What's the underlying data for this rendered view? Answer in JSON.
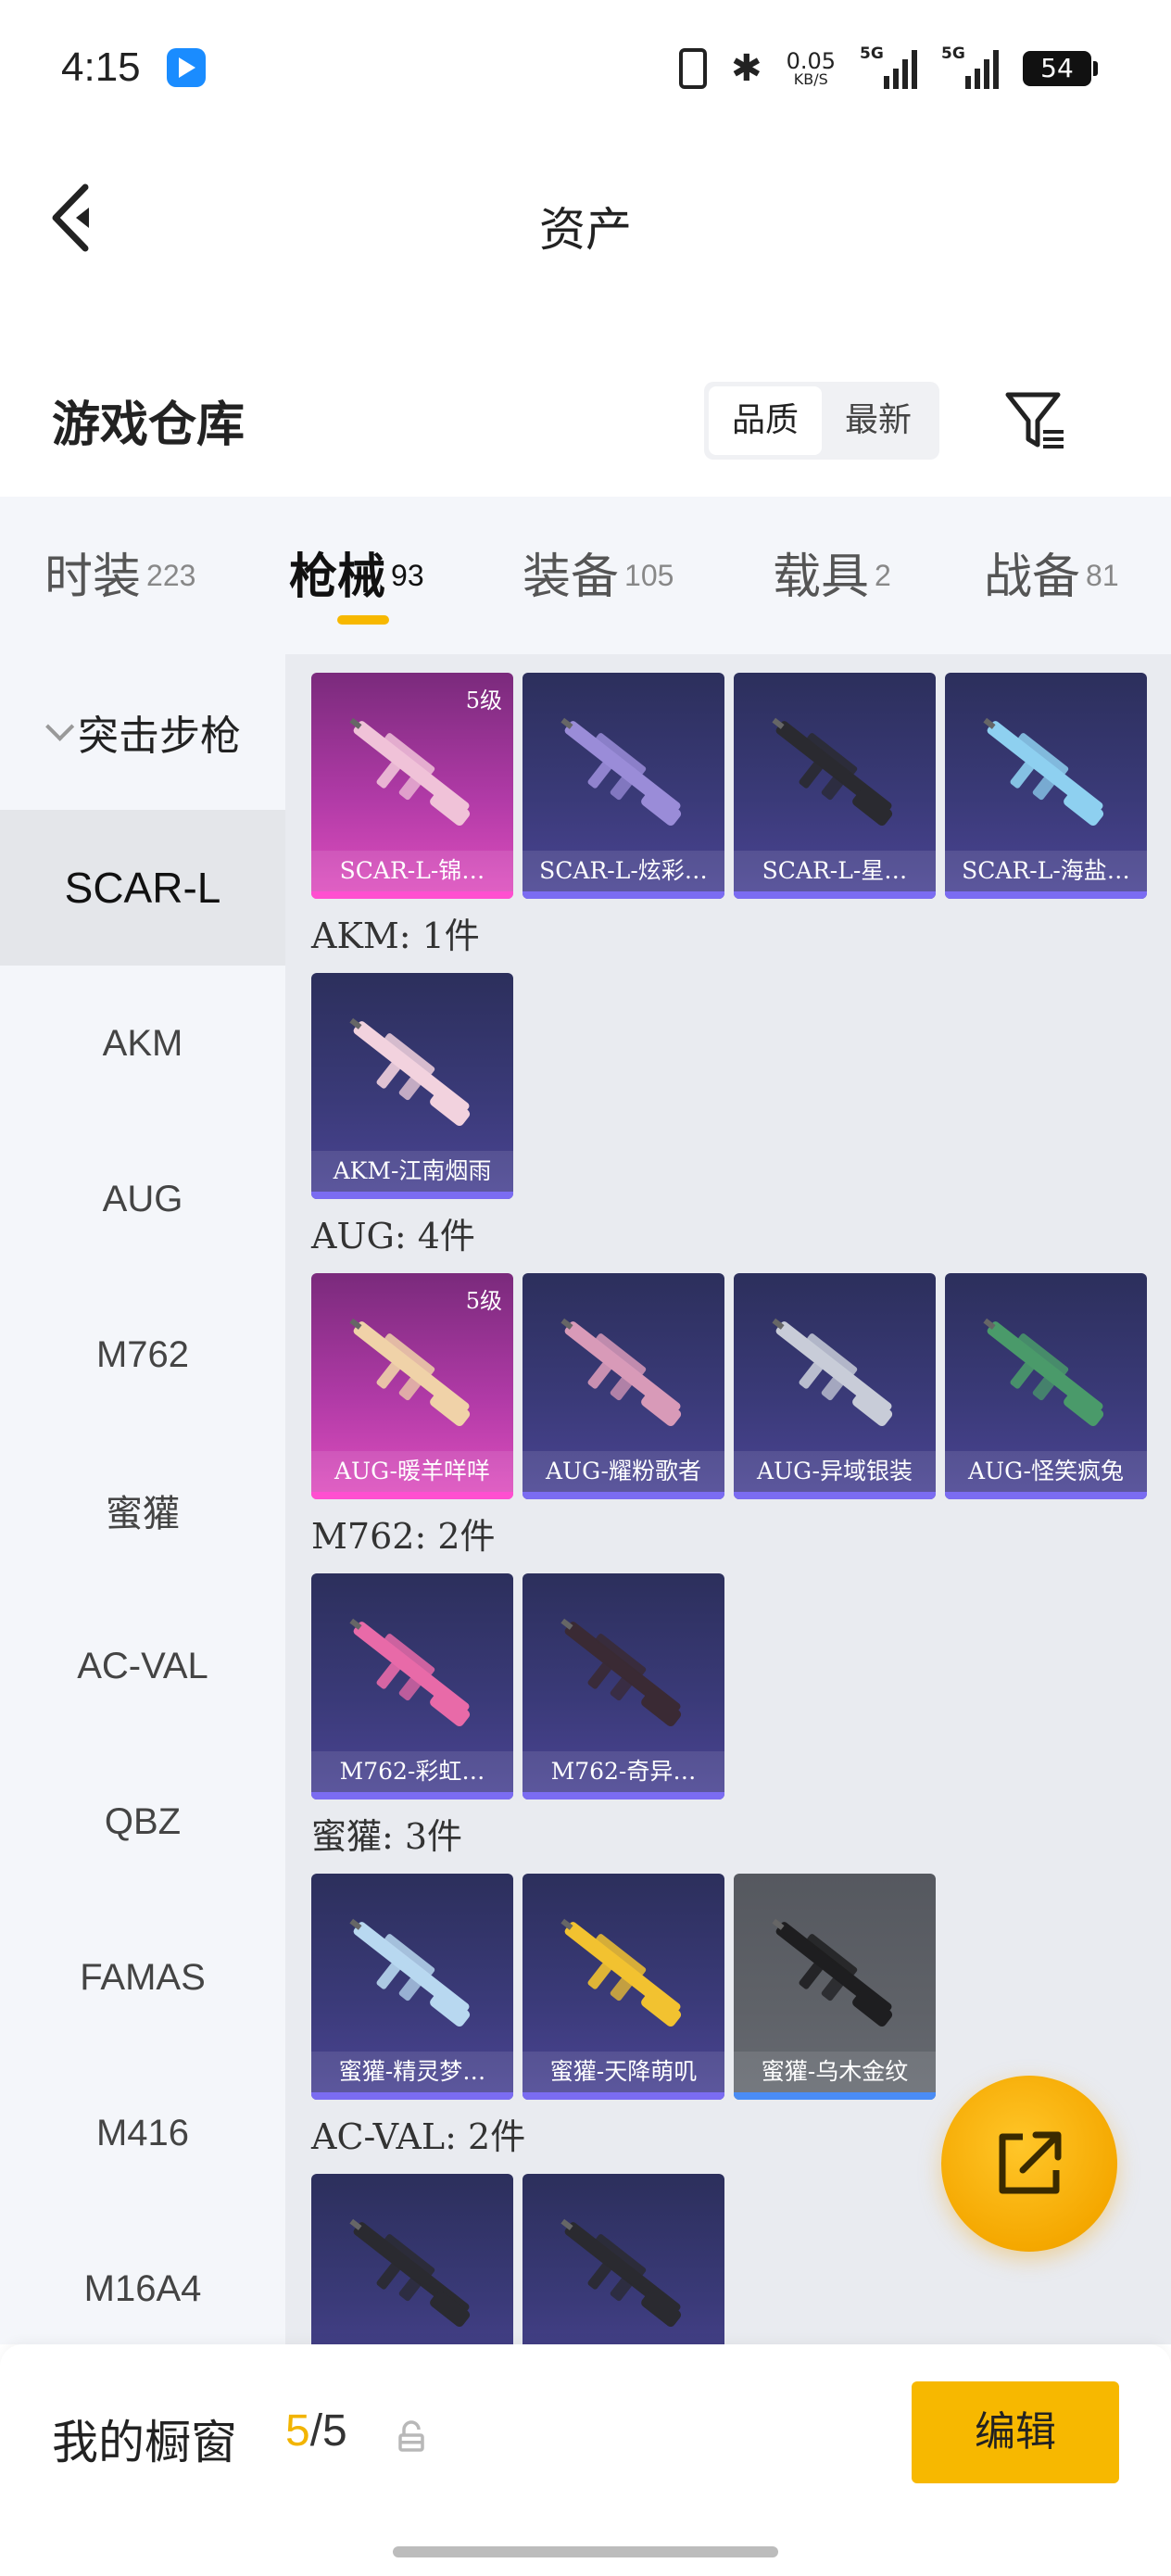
{
  "status": {
    "time": "4:15",
    "net_speed": "0.05",
    "net_unit": "KB/S",
    "sim1": "5G",
    "sim2": "5G",
    "battery": "54"
  },
  "header": {
    "title": "资产"
  },
  "warehouse": {
    "title": "游戏仓库",
    "sort": [
      "品质",
      "最新"
    ]
  },
  "tabs": [
    {
      "label": "时装",
      "count": "223"
    },
    {
      "label": "枪械",
      "count": "93"
    },
    {
      "label": "装备",
      "count": "105"
    },
    {
      "label": "载具",
      "count": "2"
    },
    {
      "label": "战备",
      "count": "81"
    }
  ],
  "sidebar": {
    "group": "突击步枪",
    "items": [
      "SCAR-L",
      "AKM",
      "AUG",
      "M762",
      "蜜獾",
      "AC-VAL",
      "QBZ",
      "FAMAS",
      "M416",
      "M16A4"
    ]
  },
  "sections": [
    {
      "title": "",
      "items": [
        {
          "name": "SCAR-L-锦…",
          "level": "5级",
          "quality": "q5",
          "color": "#f0c2d8"
        },
        {
          "name": "SCAR-L-炫彩…",
          "level": "",
          "quality": "q4",
          "color": "#9a8cd8"
        },
        {
          "name": "SCAR-L-星…",
          "level": "",
          "quality": "q4",
          "color": "#2a2a30"
        },
        {
          "name": "SCAR-L-海盐…",
          "level": "",
          "quality": "q4",
          "color": "#8ed0f0"
        }
      ]
    },
    {
      "title": "AKM: 1件",
      "items": [
        {
          "name": "AKM-江南烟雨",
          "level": "",
          "quality": "q4",
          "color": "#f2d2de"
        }
      ]
    },
    {
      "title": "AUG: 4件",
      "items": [
        {
          "name": "AUG-暖羊咩咩",
          "level": "5级",
          "quality": "q5",
          "color": "#f0d2a8"
        },
        {
          "name": "AUG-耀粉歌者",
          "level": "",
          "quality": "q4",
          "color": "#d89ab8"
        },
        {
          "name": "AUG-异域银装",
          "level": "",
          "quality": "q4",
          "color": "#c8ccd8"
        },
        {
          "name": "AUG-怪笑疯兔",
          "level": "",
          "quality": "q4",
          "color": "#4a9a6a"
        }
      ]
    },
    {
      "title": "M762: 2件",
      "items": [
        {
          "name": "M762-彩虹…",
          "level": "",
          "quality": "q4",
          "color": "#e86aa8"
        },
        {
          "name": "M762-奇异…",
          "level": "",
          "quality": "q4",
          "color": "#3a2a34"
        }
      ]
    },
    {
      "title": "蜜獾: 3件",
      "items": [
        {
          "name": "蜜獾-精灵梦…",
          "level": "",
          "quality": "q4",
          "color": "#b8d8f0"
        },
        {
          "name": "蜜獾-天降萌叽",
          "level": "",
          "quality": "q4",
          "color": "#f2c230"
        },
        {
          "name": "蜜獾-乌木金纹",
          "level": "",
          "quality": "q-gray",
          "color": "#1e1e20"
        }
      ]
    },
    {
      "title": "AC-VAL: 2件",
      "items": [
        {
          "name": "",
          "level": "",
          "quality": "q4",
          "color": "#2a2a30"
        },
        {
          "name": "",
          "level": "",
          "quality": "q4",
          "color": "#2a2a30"
        }
      ]
    }
  ],
  "showcase": {
    "label": "我的橱窗",
    "current": "5",
    "total": "/5",
    "edit_label": "编辑"
  }
}
